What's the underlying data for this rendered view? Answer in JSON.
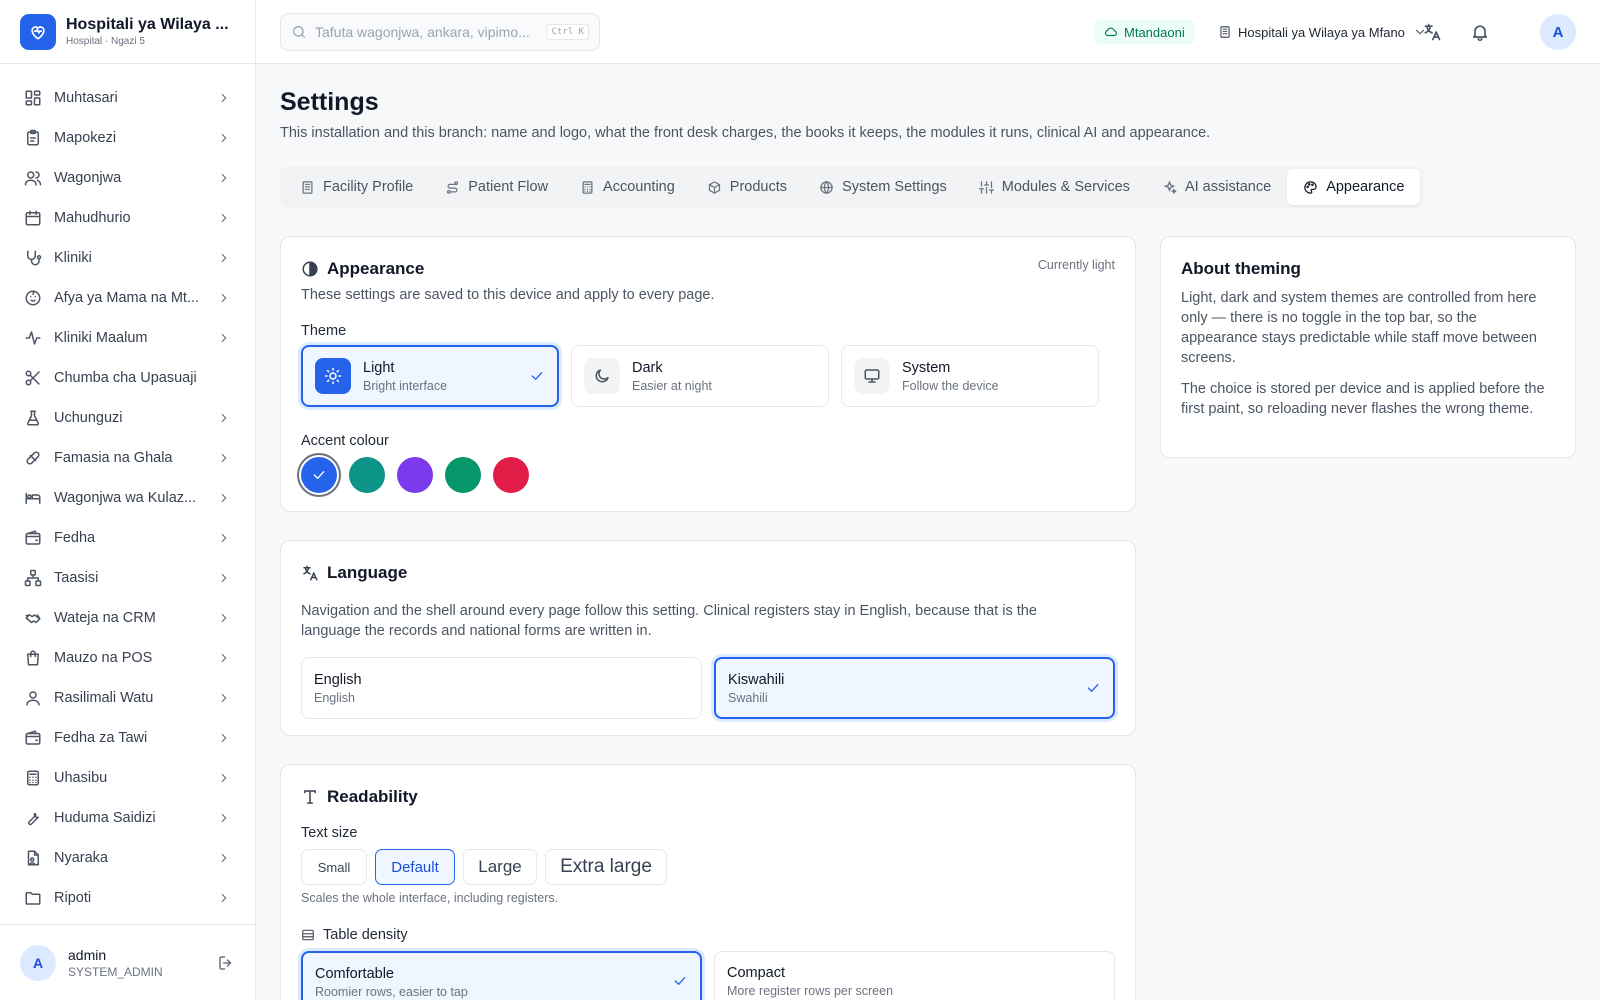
{
  "colors": {
    "accent": "#2563eb",
    "online": "#047857"
  },
  "brand": {
    "name": "Hospitali ya Wilaya ...",
    "subtitle": "Hospital · Ngazi 5"
  },
  "sidebar": {
    "items": [
      {
        "label": "Muhtasari",
        "icon": "dashboard-grid-icon",
        "has_children": true
      },
      {
        "label": "Mapokezi",
        "icon": "clipboard-icon",
        "has_children": true
      },
      {
        "label": "Wagonjwa",
        "icon": "users-icon",
        "has_children": true
      },
      {
        "label": "Mahudhurio",
        "icon": "calendar-icon",
        "has_children": true
      },
      {
        "label": "Kliniki",
        "icon": "stethoscope-icon",
        "has_children": true
      },
      {
        "label": "Afya ya Mama na Mt...",
        "icon": "baby-icon",
        "has_children": true
      },
      {
        "label": "Kliniki Maalum",
        "icon": "activity-icon",
        "has_children": true
      },
      {
        "label": "Chumba cha Upasuaji",
        "icon": "scissors-icon",
        "has_children": false
      },
      {
        "label": "Uchunguzi",
        "icon": "flask-icon",
        "has_children": true
      },
      {
        "label": "Famasia na Ghala",
        "icon": "pill-icon",
        "has_children": true
      },
      {
        "label": "Wagonjwa wa Kulaz...",
        "icon": "bed-icon",
        "has_children": true
      },
      {
        "label": "Fedha",
        "icon": "wallet-icon",
        "has_children": true
      },
      {
        "label": "Taasisi",
        "icon": "network-icon",
        "has_children": true
      },
      {
        "label": "Wateja na CRM",
        "icon": "handshake-icon",
        "has_children": true
      },
      {
        "label": "Mauzo na POS",
        "icon": "shopping-bag-icon",
        "has_children": true
      },
      {
        "label": "Rasilimali Watu",
        "icon": "user-icon",
        "has_children": true
      },
      {
        "label": "Fedha za Tawi",
        "icon": "wallet-icon",
        "has_children": true
      },
      {
        "label": "Uhasibu",
        "icon": "calculator-icon",
        "has_children": true
      },
      {
        "label": "Huduma Saidizi",
        "icon": "wrench-icon",
        "has_children": true
      },
      {
        "label": "Nyaraka",
        "icon": "file-icon",
        "has_children": true
      },
      {
        "label": "Ripoti",
        "icon": "folder-icon",
        "has_children": true
      }
    ]
  },
  "user": {
    "initial": "A",
    "name": "admin",
    "role": "SYSTEM_ADMIN"
  },
  "topbar": {
    "search_placeholder": "Tafuta wagonjwa, ankara, vipimo...",
    "shortcut": "Ctrl K",
    "status": "Mtandaoni",
    "branch": "Hospitali ya Wilaya ya Mfano",
    "avatar_initial": "A"
  },
  "page": {
    "title": "Settings",
    "description": "This installation and this branch: name and logo, what the front desk charges, the books it keeps, the modules it runs, clinical AI and appearance."
  },
  "tabs": [
    {
      "label": "Facility Profile",
      "icon": "building-icon",
      "active": false
    },
    {
      "label": "Patient Flow",
      "icon": "route-icon",
      "active": false
    },
    {
      "label": "Accounting",
      "icon": "calculator-icon",
      "active": false
    },
    {
      "label": "Products",
      "icon": "package-icon",
      "active": false
    },
    {
      "label": "System Settings",
      "icon": "globe-icon",
      "active": false
    },
    {
      "label": "Modules & Services",
      "icon": "sliders-icon",
      "active": false
    },
    {
      "label": "AI assistance",
      "icon": "sparkles-icon",
      "active": false
    },
    {
      "label": "Appearance",
      "icon": "palette-icon",
      "active": true
    }
  ],
  "appearance": {
    "title": "Appearance",
    "status": "Currently light",
    "description": "These settings are saved to this device and apply to every page.",
    "theme_label": "Theme",
    "themes": [
      {
        "title": "Light",
        "subtitle": "Bright interface",
        "icon": "sun-icon",
        "selected": true
      },
      {
        "title": "Dark",
        "subtitle": "Easier at night",
        "icon": "moon-icon",
        "selected": false
      },
      {
        "title": "System",
        "subtitle": "Follow the device",
        "icon": "monitor-icon",
        "selected": false
      }
    ],
    "accent_label": "Accent colour",
    "accents": [
      {
        "color": "#2563eb",
        "selected": true
      },
      {
        "color": "#0d9488",
        "selected": false
      },
      {
        "color": "#7c3aed",
        "selected": false
      },
      {
        "color": "#059669",
        "selected": false
      },
      {
        "color": "#e11d48",
        "selected": false
      }
    ]
  },
  "language": {
    "title": "Language",
    "description": "Navigation and the shell around every page follow this setting. Clinical registers stay in English, because that is the language the records and national forms are written in.",
    "options": [
      {
        "title": "English",
        "subtitle": "English",
        "selected": false
      },
      {
        "title": "Kiswahili",
        "subtitle": "Swahili",
        "selected": true
      }
    ]
  },
  "readability": {
    "title": "Readability",
    "text_size_label": "Text size",
    "sizes": [
      {
        "label": "Small",
        "selected": false
      },
      {
        "label": "Default",
        "selected": true
      },
      {
        "label": "Large",
        "selected": false
      },
      {
        "label": "Extra large",
        "selected": false
      }
    ],
    "hint": "Scales the whole interface, including registers.",
    "density_label": "Table density",
    "densities": [
      {
        "title": "Comfortable",
        "subtitle": "Roomier rows, easier to tap",
        "selected": true
      },
      {
        "title": "Compact",
        "subtitle": "More register rows per screen",
        "selected": false
      }
    ]
  },
  "about": {
    "title": "About theming",
    "p1": "Light, dark and system themes are controlled from here only — there is no toggle in the top bar, so the appearance stays predictable while staff move between screens.",
    "p2": "The choice is stored per device and is applied before the first paint, so reloading never flashes the wrong theme."
  }
}
